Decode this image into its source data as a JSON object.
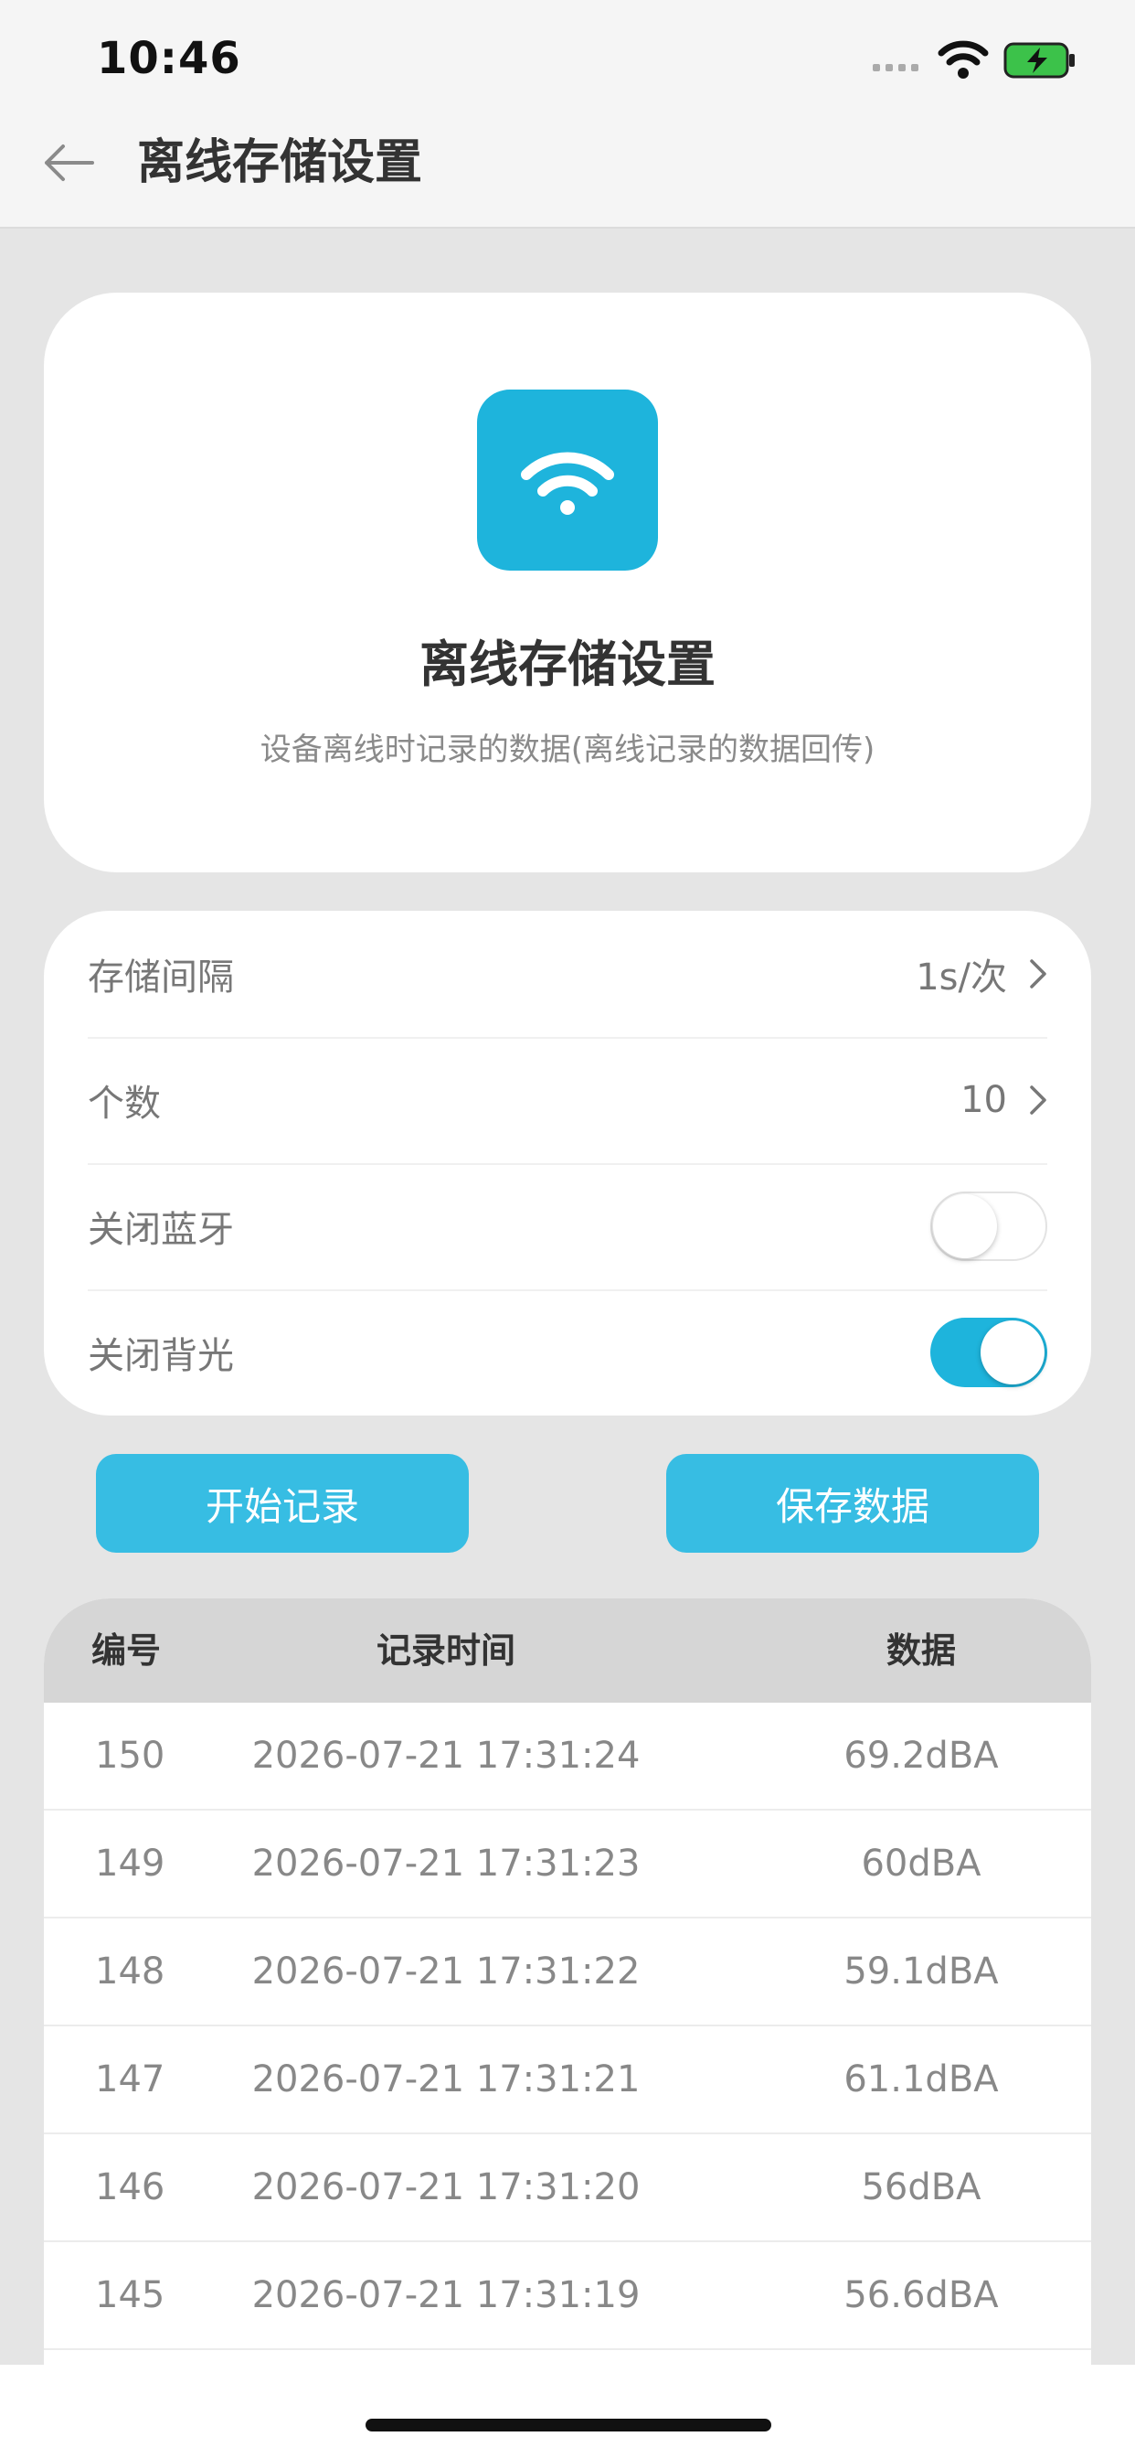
{
  "status": {
    "time": "10:46"
  },
  "nav": {
    "title": "离线存储设置"
  },
  "hero": {
    "title": "离线存储设置",
    "subtitle": "设备离线时记录的数据(离线记录的数据回传)"
  },
  "settings": {
    "interval": {
      "label": "存储间隔",
      "value": "1s/次"
    },
    "count": {
      "label": "个数",
      "value": "10"
    },
    "bluetooth": {
      "label": "关闭蓝牙",
      "on": false
    },
    "backlight": {
      "label": "关闭背光",
      "on": true
    }
  },
  "buttons": {
    "start": "开始记录",
    "save": "保存数据"
  },
  "table": {
    "headers": [
      "编号",
      "记录时间",
      "数据"
    ],
    "rows": [
      [
        "150",
        "2026-07-21 17:31:24",
        "69.2dBA"
      ],
      [
        "149",
        "2026-07-21 17:31:23",
        "60dBA"
      ],
      [
        "148",
        "2026-07-21 17:31:22",
        "59.1dBA"
      ],
      [
        "147",
        "2026-07-21 17:31:21",
        "61.1dBA"
      ],
      [
        "146",
        "2026-07-21 17:31:20",
        "56dBA"
      ],
      [
        "145",
        "2026-07-21 17:31:19",
        "56.6dBA"
      ]
    ]
  },
  "colors": {
    "accent": "#1eb4dc",
    "button": "#37bde3",
    "background": "#e5e5e5"
  },
  "icons": {
    "back": "arrow-left-icon",
    "hero": "wifi-icon",
    "chevron": "chevron-right-icon"
  }
}
